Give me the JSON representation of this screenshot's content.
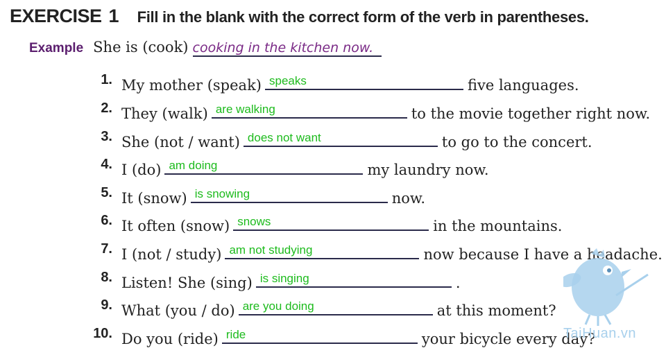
{
  "header": {
    "exercise_word": "EXERCISE",
    "exercise_number": "1",
    "instruction": "Fill in the blank with the correct form of the verb in parentheses."
  },
  "example": {
    "label": "Example",
    "prompt": "She is (cook)",
    "answer": "cooking in the kitchen now."
  },
  "items": [
    {
      "num": "1.",
      "before": "My mother (speak)",
      "answer": "speaks",
      "after": "five languages."
    },
    {
      "num": "2.",
      "before": "They (walk)",
      "answer": "are walking",
      "after": "to the movie together right now."
    },
    {
      "num": "3.",
      "before": "She (not / want)",
      "answer": "does not want",
      "after": "to go to the concert."
    },
    {
      "num": "4.",
      "before": "I (do)",
      "answer": "am doing",
      "after": "my laundry now."
    },
    {
      "num": "5.",
      "before": "It (snow)",
      "answer": "is snowing",
      "after": "now."
    },
    {
      "num": "6.",
      "before": "It often (snow)",
      "answer": "snows",
      "after": "in the mountains."
    },
    {
      "num": "7.",
      "before": "I (not / study)",
      "answer": "am not studying",
      "after": "now because I have a headache."
    },
    {
      "num": "8.",
      "before": "Listen! She (sing)",
      "answer": "is singing",
      "after": "."
    },
    {
      "num": "9.",
      "before": "What (you / do)",
      "answer": "are you doing",
      "after": "at this moment?"
    },
    {
      "num": "10.",
      "before": "Do you (ride)",
      "answer": "ride",
      "after": "your bicycle every day?"
    }
  ],
  "watermark": "TaiHuan.vn",
  "colors": {
    "answer_green": "#1dbb1d",
    "example_purple": "#5b1e6e",
    "bird_blue": "#a8d0ec"
  }
}
